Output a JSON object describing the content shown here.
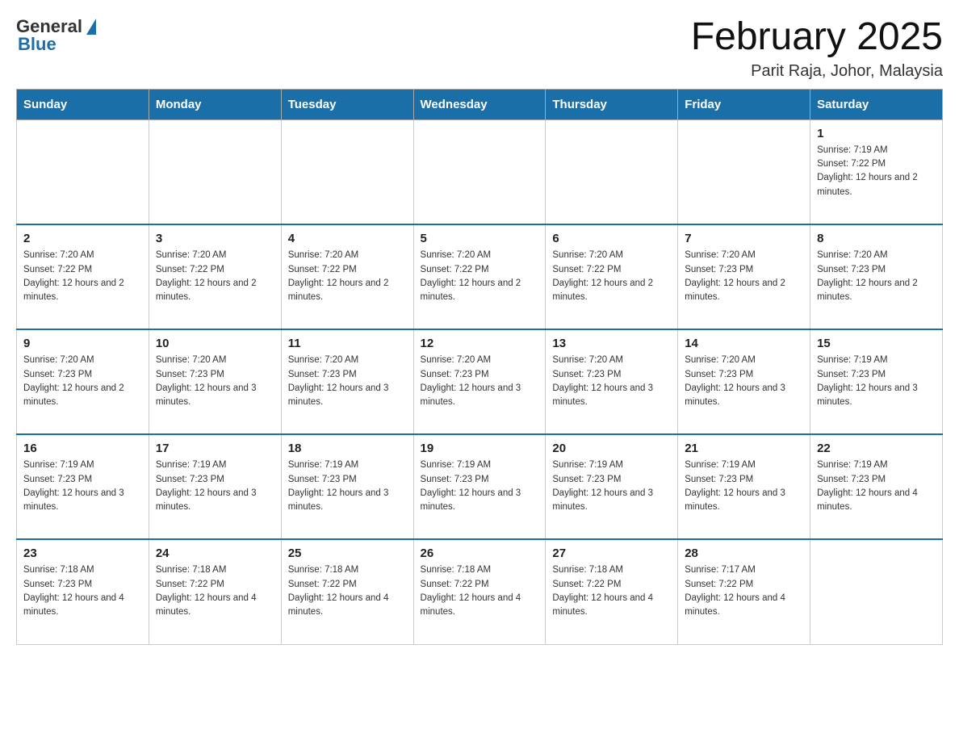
{
  "header": {
    "logo_general": "General",
    "logo_blue": "Blue",
    "month_title": "February 2025",
    "location": "Parit Raja, Johor, Malaysia"
  },
  "weekdays": [
    "Sunday",
    "Monday",
    "Tuesday",
    "Wednesday",
    "Thursday",
    "Friday",
    "Saturday"
  ],
  "weeks": [
    [
      {
        "day": "",
        "sunrise": "",
        "sunset": "",
        "daylight": ""
      },
      {
        "day": "",
        "sunrise": "",
        "sunset": "",
        "daylight": ""
      },
      {
        "day": "",
        "sunrise": "",
        "sunset": "",
        "daylight": ""
      },
      {
        "day": "",
        "sunrise": "",
        "sunset": "",
        "daylight": ""
      },
      {
        "day": "",
        "sunrise": "",
        "sunset": "",
        "daylight": ""
      },
      {
        "day": "",
        "sunrise": "",
        "sunset": "",
        "daylight": ""
      },
      {
        "day": "1",
        "sunrise": "Sunrise: 7:19 AM",
        "sunset": "Sunset: 7:22 PM",
        "daylight": "Daylight: 12 hours and 2 minutes."
      }
    ],
    [
      {
        "day": "2",
        "sunrise": "Sunrise: 7:20 AM",
        "sunset": "Sunset: 7:22 PM",
        "daylight": "Daylight: 12 hours and 2 minutes."
      },
      {
        "day": "3",
        "sunrise": "Sunrise: 7:20 AM",
        "sunset": "Sunset: 7:22 PM",
        "daylight": "Daylight: 12 hours and 2 minutes."
      },
      {
        "day": "4",
        "sunrise": "Sunrise: 7:20 AM",
        "sunset": "Sunset: 7:22 PM",
        "daylight": "Daylight: 12 hours and 2 minutes."
      },
      {
        "day": "5",
        "sunrise": "Sunrise: 7:20 AM",
        "sunset": "Sunset: 7:22 PM",
        "daylight": "Daylight: 12 hours and 2 minutes."
      },
      {
        "day": "6",
        "sunrise": "Sunrise: 7:20 AM",
        "sunset": "Sunset: 7:22 PM",
        "daylight": "Daylight: 12 hours and 2 minutes."
      },
      {
        "day": "7",
        "sunrise": "Sunrise: 7:20 AM",
        "sunset": "Sunset: 7:23 PM",
        "daylight": "Daylight: 12 hours and 2 minutes."
      },
      {
        "day": "8",
        "sunrise": "Sunrise: 7:20 AM",
        "sunset": "Sunset: 7:23 PM",
        "daylight": "Daylight: 12 hours and 2 minutes."
      }
    ],
    [
      {
        "day": "9",
        "sunrise": "Sunrise: 7:20 AM",
        "sunset": "Sunset: 7:23 PM",
        "daylight": "Daylight: 12 hours and 2 minutes."
      },
      {
        "day": "10",
        "sunrise": "Sunrise: 7:20 AM",
        "sunset": "Sunset: 7:23 PM",
        "daylight": "Daylight: 12 hours and 3 minutes."
      },
      {
        "day": "11",
        "sunrise": "Sunrise: 7:20 AM",
        "sunset": "Sunset: 7:23 PM",
        "daylight": "Daylight: 12 hours and 3 minutes."
      },
      {
        "day": "12",
        "sunrise": "Sunrise: 7:20 AM",
        "sunset": "Sunset: 7:23 PM",
        "daylight": "Daylight: 12 hours and 3 minutes."
      },
      {
        "day": "13",
        "sunrise": "Sunrise: 7:20 AM",
        "sunset": "Sunset: 7:23 PM",
        "daylight": "Daylight: 12 hours and 3 minutes."
      },
      {
        "day": "14",
        "sunrise": "Sunrise: 7:20 AM",
        "sunset": "Sunset: 7:23 PM",
        "daylight": "Daylight: 12 hours and 3 minutes."
      },
      {
        "day": "15",
        "sunrise": "Sunrise: 7:19 AM",
        "sunset": "Sunset: 7:23 PM",
        "daylight": "Daylight: 12 hours and 3 minutes."
      }
    ],
    [
      {
        "day": "16",
        "sunrise": "Sunrise: 7:19 AM",
        "sunset": "Sunset: 7:23 PM",
        "daylight": "Daylight: 12 hours and 3 minutes."
      },
      {
        "day": "17",
        "sunrise": "Sunrise: 7:19 AM",
        "sunset": "Sunset: 7:23 PM",
        "daylight": "Daylight: 12 hours and 3 minutes."
      },
      {
        "day": "18",
        "sunrise": "Sunrise: 7:19 AM",
        "sunset": "Sunset: 7:23 PM",
        "daylight": "Daylight: 12 hours and 3 minutes."
      },
      {
        "day": "19",
        "sunrise": "Sunrise: 7:19 AM",
        "sunset": "Sunset: 7:23 PM",
        "daylight": "Daylight: 12 hours and 3 minutes."
      },
      {
        "day": "20",
        "sunrise": "Sunrise: 7:19 AM",
        "sunset": "Sunset: 7:23 PM",
        "daylight": "Daylight: 12 hours and 3 minutes."
      },
      {
        "day": "21",
        "sunrise": "Sunrise: 7:19 AM",
        "sunset": "Sunset: 7:23 PM",
        "daylight": "Daylight: 12 hours and 3 minutes."
      },
      {
        "day": "22",
        "sunrise": "Sunrise: 7:19 AM",
        "sunset": "Sunset: 7:23 PM",
        "daylight": "Daylight: 12 hours and 4 minutes."
      }
    ],
    [
      {
        "day": "23",
        "sunrise": "Sunrise: 7:18 AM",
        "sunset": "Sunset: 7:23 PM",
        "daylight": "Daylight: 12 hours and 4 minutes."
      },
      {
        "day": "24",
        "sunrise": "Sunrise: 7:18 AM",
        "sunset": "Sunset: 7:22 PM",
        "daylight": "Daylight: 12 hours and 4 minutes."
      },
      {
        "day": "25",
        "sunrise": "Sunrise: 7:18 AM",
        "sunset": "Sunset: 7:22 PM",
        "daylight": "Daylight: 12 hours and 4 minutes."
      },
      {
        "day": "26",
        "sunrise": "Sunrise: 7:18 AM",
        "sunset": "Sunset: 7:22 PM",
        "daylight": "Daylight: 12 hours and 4 minutes."
      },
      {
        "day": "27",
        "sunrise": "Sunrise: 7:18 AM",
        "sunset": "Sunset: 7:22 PM",
        "daylight": "Daylight: 12 hours and 4 minutes."
      },
      {
        "day": "28",
        "sunrise": "Sunrise: 7:17 AM",
        "sunset": "Sunset: 7:22 PM",
        "daylight": "Daylight: 12 hours and 4 minutes."
      },
      {
        "day": "",
        "sunrise": "",
        "sunset": "",
        "daylight": ""
      }
    ]
  ]
}
